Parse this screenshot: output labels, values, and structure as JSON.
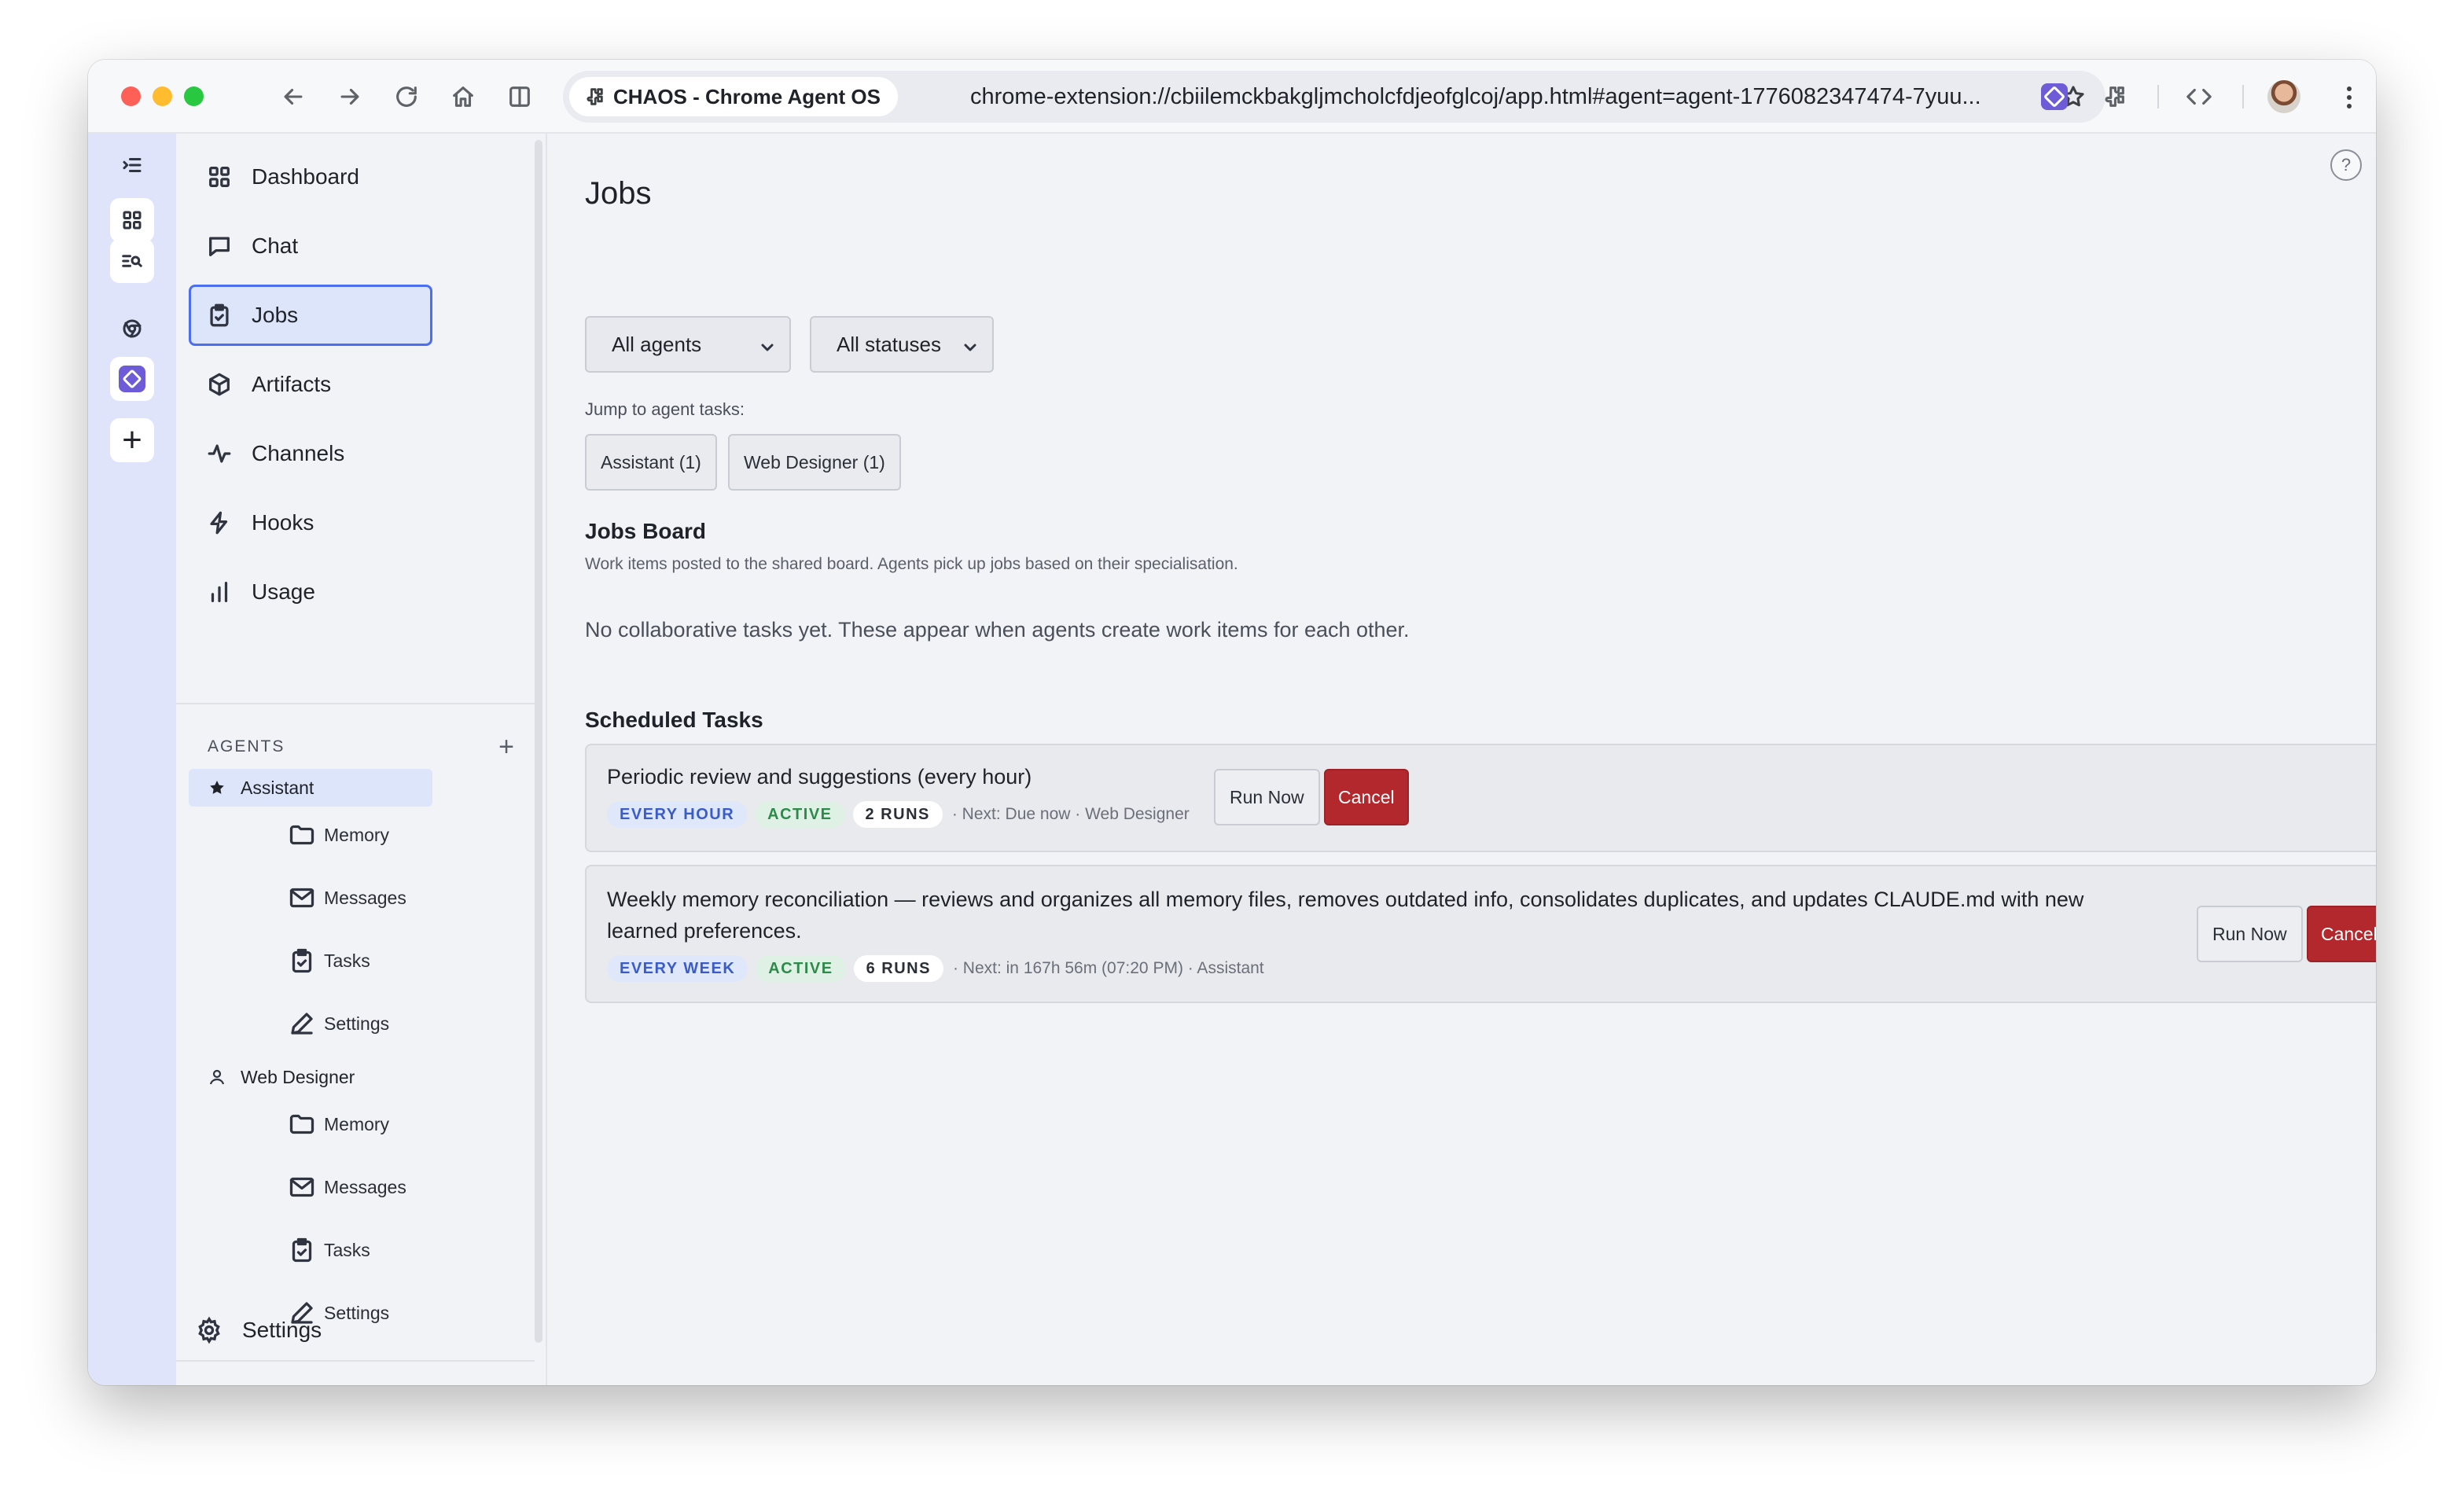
{
  "browser": {
    "site_chip": "CHAOS - Chrome Agent OS",
    "url": "chrome-extension://cbiilemckbakgljmcholcfdjeofglcoj/app.html#agent=agent-1776082347474-7yuu..."
  },
  "rail": {
    "icons": [
      "collapse-icon",
      "grid-icon",
      "search-list-icon",
      "chrome-icon",
      "chaos-app-icon",
      "plus-icon"
    ],
    "plus_label": "+"
  },
  "sidebar": {
    "nav": [
      {
        "label": "Dashboard",
        "icon": "dashboard-icon"
      },
      {
        "label": "Chat",
        "icon": "chat-icon"
      },
      {
        "label": "Jobs",
        "icon": "clipboard-check-icon",
        "active": true
      },
      {
        "label": "Artifacts",
        "icon": "cube-icon"
      },
      {
        "label": "Channels",
        "icon": "activity-icon"
      },
      {
        "label": "Hooks",
        "icon": "bolt-icon"
      },
      {
        "label": "Usage",
        "icon": "bar-chart-icon"
      }
    ],
    "agents_label": "AGENTS",
    "agents_add": "+",
    "agents": [
      {
        "name": "Assistant",
        "icon": "star-icon",
        "selected": true,
        "items": [
          "Memory",
          "Messages",
          "Tasks",
          "Settings"
        ]
      },
      {
        "name": "Web Designer",
        "icon": "user-icon",
        "selected": false,
        "items": [
          "Memory",
          "Messages",
          "Tasks",
          "Settings"
        ]
      }
    ],
    "settings_label": "Settings"
  },
  "main": {
    "title": "Jobs",
    "help": "?",
    "filters": {
      "agent": "All agents",
      "status": "All statuses"
    },
    "jump_label": "Jump to agent tasks:",
    "jump_buttons": [
      "Assistant (1)",
      "Web Designer (1)"
    ],
    "jobs_board": {
      "title": "Jobs Board",
      "subtitle": "Work items posted to the shared board. Agents pick up jobs based on their specialisation.",
      "empty": "No collaborative tasks yet. These appear when agents create work items for each other."
    },
    "scheduled": {
      "title": "Scheduled Tasks",
      "tasks": [
        {
          "title": "Periodic review and suggestions (every hour)",
          "schedule": "EVERY HOUR",
          "status": "ACTIVE",
          "runs": "2 RUNS",
          "meta": "· Next: Due now · Web Designer",
          "run_label": "Run Now",
          "cancel_label": "Cancel"
        },
        {
          "title_line1": "Weekly memory reconciliation — reviews and organizes all memory files, removes outdated info, consolidates duplicates, and updates CLAUDE.md with new",
          "title_line2": "learned preferences.",
          "schedule": "EVERY WEEK",
          "status": "ACTIVE",
          "runs": "6 RUNS",
          "meta": "· Next: in 167h 56m (07:20 PM) · Assistant",
          "run_label": "Run Now",
          "cancel_label": "Cancel"
        }
      ]
    }
  },
  "colors": {
    "accent": "#4c6ef0",
    "active_nav_bg": "#dde5fb",
    "rail_bg": "#dfe4fb",
    "cancel_bg": "#b3282d",
    "badge_active": "#2e8a4a",
    "badge_schedule": "#3a5cc9"
  }
}
